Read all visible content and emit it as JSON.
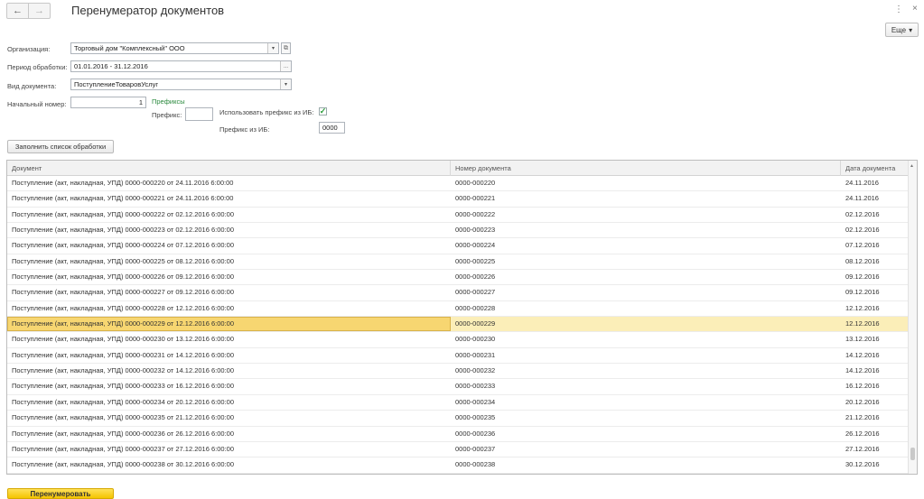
{
  "header": {
    "back_icon": "←",
    "forward_icon": "→",
    "title": "Перенумератор документов",
    "kebab_icon": "⋮",
    "close_icon": "×",
    "more_label": "Еще",
    "more_arrow": "▾"
  },
  "form": {
    "organization_label": "Организация:",
    "organization_value": "Торговый дом \"Комплексный\" ООО",
    "period_label": "Период обработки:",
    "period_value": "01.01.2016 - 31.12.2016",
    "doctype_label": "Вид документа:",
    "doctype_value": "ПоступлениеТоваровУслуг",
    "start_number_label": "Начальный номер:",
    "start_number_value": "1",
    "prefixes_title": "Префиксы",
    "prefix_label": "Префикс:",
    "prefix_value": "",
    "use_ib_prefix_label": "Использовать префикс из ИБ:",
    "use_ib_prefix_checked": true,
    "check_icon": "✓",
    "ib_prefix_label": "Префикс из ИБ:",
    "ib_prefix_value": "0000",
    "dropdown_icon": "▾",
    "ellipsis_icon": "...",
    "link_icon": "⧉"
  },
  "fill_button_label": "Заполнить список обработки",
  "table": {
    "columns": [
      "Документ",
      "Номер документа",
      "Дата документа"
    ],
    "selected_index": 9,
    "rows": [
      {
        "doc": "Поступление (акт, накладная, УПД) 0000-000220 от 24.11.2016 6:00:00",
        "number": "0000-000220",
        "date": "24.11.2016"
      },
      {
        "doc": "Поступление (акт, накладная, УПД) 0000-000221 от 24.11.2016 6:00:00",
        "number": "0000-000221",
        "date": "24.11.2016"
      },
      {
        "doc": "Поступление (акт, накладная, УПД) 0000-000222 от 02.12.2016 6:00:00",
        "number": "0000-000222",
        "date": "02.12.2016"
      },
      {
        "doc": "Поступление (акт, накладная, УПД) 0000-000223 от 02.12.2016 6:00:00",
        "number": "0000-000223",
        "date": "02.12.2016"
      },
      {
        "doc": "Поступление (акт, накладная, УПД) 0000-000224 от 07.12.2016 6:00:00",
        "number": "0000-000224",
        "date": "07.12.2016"
      },
      {
        "doc": "Поступление (акт, накладная, УПД) 0000-000225 от 08.12.2016 6:00:00",
        "number": "0000-000225",
        "date": "08.12.2016"
      },
      {
        "doc": "Поступление (акт, накладная, УПД) 0000-000226 от 09.12.2016 6:00:00",
        "number": "0000-000226",
        "date": "09.12.2016"
      },
      {
        "doc": "Поступление (акт, накладная, УПД) 0000-000227 от 09.12.2016 6:00:00",
        "number": "0000-000227",
        "date": "09.12.2016"
      },
      {
        "doc": "Поступление (акт, накладная, УПД) 0000-000228 от 12.12.2016 6:00:00",
        "number": "0000-000228",
        "date": "12.12.2016"
      },
      {
        "doc": "Поступление (акт, накладная, УПД) 0000-000229 от 12.12.2016 6:00:00",
        "number": "0000-000229",
        "date": "12.12.2016"
      },
      {
        "doc": "Поступление (акт, накладная, УПД) 0000-000230 от 13.12.2016 6:00:00",
        "number": "0000-000230",
        "date": "13.12.2016"
      },
      {
        "doc": "Поступление (акт, накладная, УПД) 0000-000231 от 14.12.2016 6:00:00",
        "number": "0000-000231",
        "date": "14.12.2016"
      },
      {
        "doc": "Поступление (акт, накладная, УПД) 0000-000232 от 14.12.2016 6:00:00",
        "number": "0000-000232",
        "date": "14.12.2016"
      },
      {
        "doc": "Поступление (акт, накладная, УПД) 0000-000233 от 16.12.2016 6:00:00",
        "number": "0000-000233",
        "date": "16.12.2016"
      },
      {
        "doc": "Поступление (акт, накладная, УПД) 0000-000234 от 20.12.2016 6:00:00",
        "number": "0000-000234",
        "date": "20.12.2016"
      },
      {
        "doc": "Поступление (акт, накладная, УПД) 0000-000235 от 21.12.2016 6:00:00",
        "number": "0000-000235",
        "date": "21.12.2016"
      },
      {
        "doc": "Поступление (акт, накладная, УПД) 0000-000236 от 26.12.2016 6:00:00",
        "number": "0000-000236",
        "date": "26.12.2016"
      },
      {
        "doc": "Поступление (акт, накладная, УПД) 0000-000237 от 27.12.2016 6:00:00",
        "number": "0000-000237",
        "date": "27.12.2016"
      },
      {
        "doc": "Поступление (акт, накладная, УПД) 0000-000238 от 30.12.2016 6:00:00",
        "number": "0000-000238",
        "date": "30.12.2016"
      }
    ],
    "scroll_up_icon": "▲"
  },
  "renumber_button_label": "Перенумеровать",
  "colors": {
    "accent_yellow": "#f5c400",
    "selected_row": "#fbeeb8",
    "selected_cell": "#f7d671",
    "prefixes_green": "#2b8a3e"
  }
}
